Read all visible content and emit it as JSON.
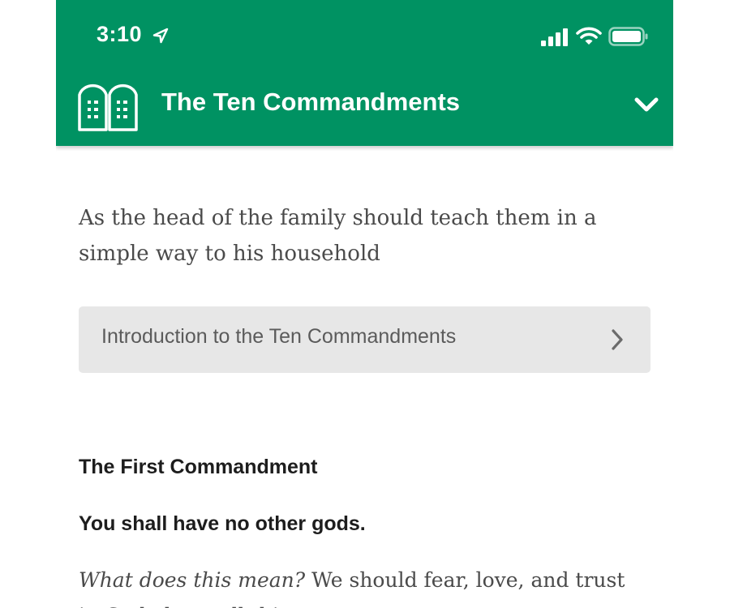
{
  "status_bar": {
    "time": "3:10",
    "location_icon": "location-arrow-icon",
    "signal_icon": "cellular-signal-icon",
    "wifi_icon": "wifi-icon",
    "battery_icon": "battery-icon"
  },
  "header": {
    "icon": "tablets-icon",
    "title": "The Ten Commandments",
    "menu_icon": "chevron-down-icon",
    "background_color": "#009262"
  },
  "content": {
    "subtitle": "As the head of the family should teach them in a simple way to his household",
    "intro_link": {
      "label": "Introduction to the Ten Commandments",
      "icon": "chevron-right-icon"
    },
    "section_heading": "The First Commandment",
    "commandment": "You shall have no other gods.",
    "question": "What does this mean?",
    "answer_start": " We should fear, love, and trust in God above all things."
  }
}
